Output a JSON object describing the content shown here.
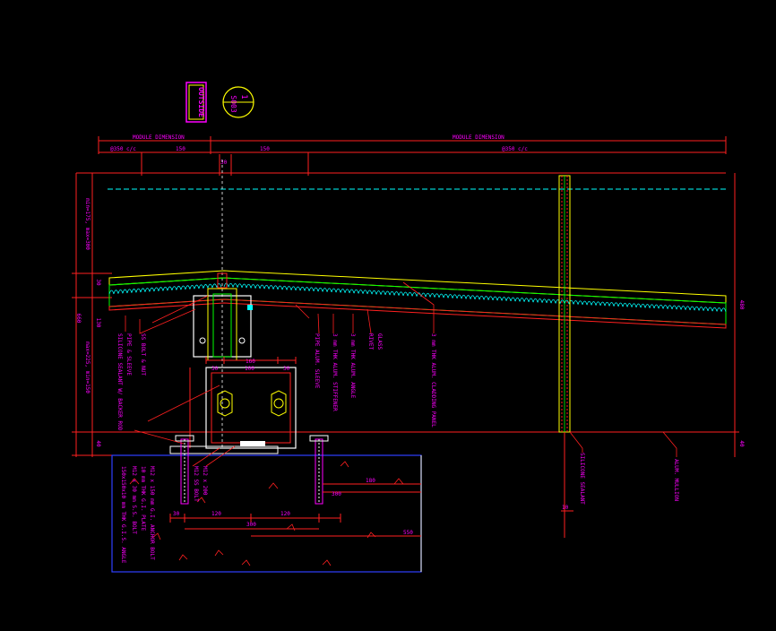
{
  "labels": {
    "outside": "OUTSIDE",
    "bubble_top": "1",
    "bubble_bottom": "S003",
    "module_left": "MODULE DIMENSION",
    "module_right": "MODULE DIMENSION",
    "left_top": "@350 c/c",
    "right_top": "@350 c/c",
    "d150a": "150",
    "d150b": "150",
    "d30top": "30",
    "left_vert": "min=175, max=300",
    "left_lower_vert": "max=225, min=150",
    "d660": "660",
    "d30l": "30",
    "d130": "130",
    "d40l": "40",
    "d40r": "40",
    "d480": "480",
    "b30a": "30",
    "b100": "100",
    "b30b": "30",
    "b160": "160",
    "c180": "180",
    "c300a": "300",
    "c30": "30",
    "c120a": "120",
    "c120b": "120",
    "c300b": "300",
    "c550": "550",
    "c10": "10",
    "n1": "PIPE & SLEEVE",
    "n2": "SILICONE SEALANT W/ BACKER ROD",
    "n3": "SS BOLT & NUT",
    "n4": "PIPE ALUM. SLEEVE",
    "n5": "3 mm THK ALUM. STIFFENER",
    "n6": "3 mm THK ALUM. ANGLE",
    "n7": "RIVET",
    "n8": "GLASS",
    "n9": "3 mm THK ALUM. CLADDING PANEL",
    "n10": "SILICONE SEALANT",
    "n11": "ALUM. MULLION",
    "s1": "M12 x 150 mm G.I. ANCHOR BOLT",
    "s2": "10 mm THK G.I. PLATE",
    "s3": "M12 x 30 mm S.S. BOLT",
    "s4": "150x150x10 mm THK G.I.S. ANGLE",
    "s5": "M12 x 200",
    "s6": "M12 SS BOLT"
  },
  "colors": {
    "red": "#ff2020",
    "magenta": "#ff00ff",
    "yellow": "#ffff00",
    "green": "#00ff00",
    "cyan": "#00ffff",
    "white": "#ffffff",
    "blue": "#3040ff"
  }
}
